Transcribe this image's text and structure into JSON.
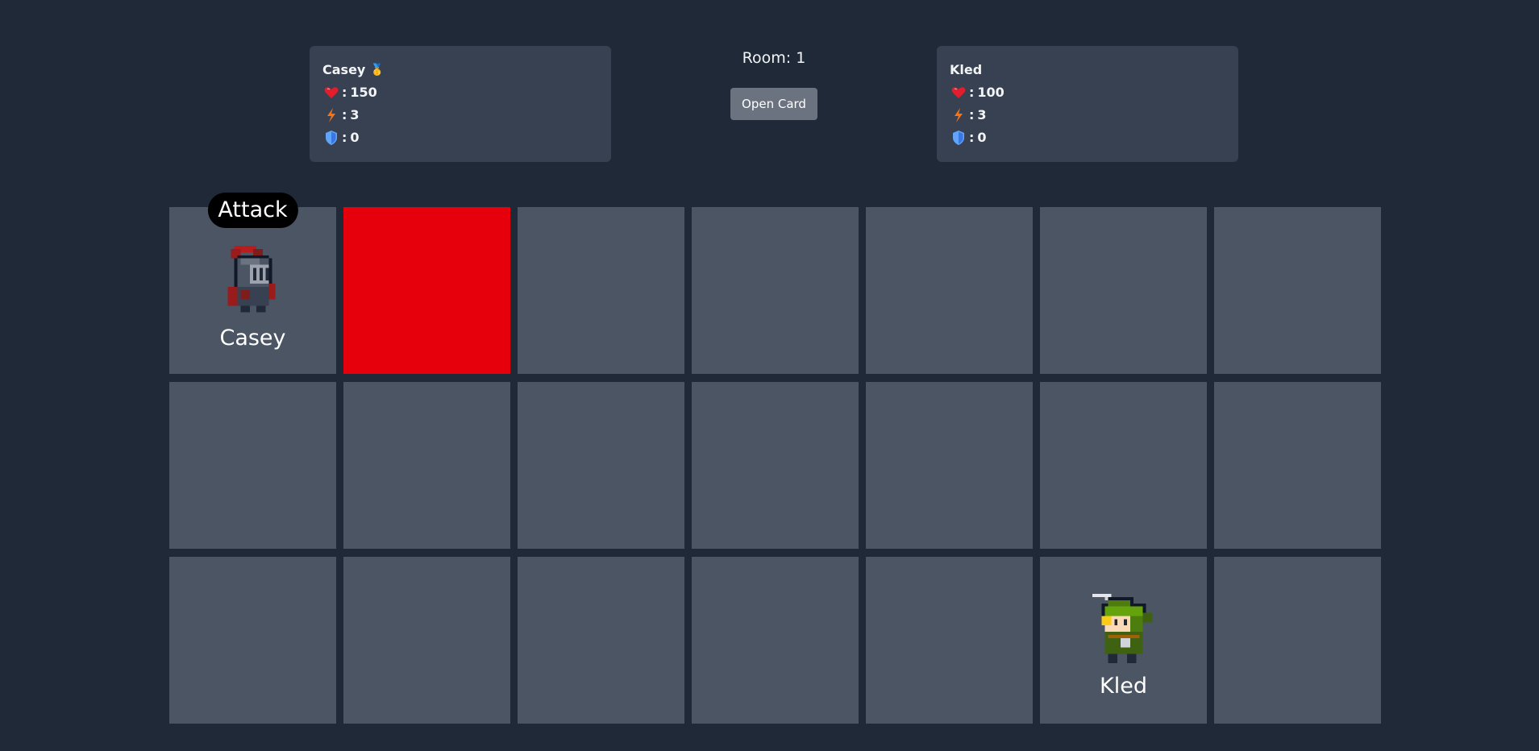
{
  "players": [
    {
      "name": "Casey",
      "badge_icon": "gold-medal-icon",
      "badge_glyph": "🥇",
      "hp": "150",
      "energy": "3",
      "shield": "0"
    },
    {
      "name": "Kled",
      "hp": "100",
      "energy": "3",
      "shield": "0"
    }
  ],
  "stat_separator": ":",
  "room": {
    "label": "Room: 1"
  },
  "open_card_button": "Open Card",
  "board": {
    "columns": 7,
    "rows": 3,
    "highlighted_cell": {
      "row": 1,
      "col": 2,
      "color": "#e5000c"
    },
    "units": [
      {
        "name": "Casey",
        "sprite": "knight-sprite-icon",
        "row": 1,
        "col": 1,
        "action": "Attack"
      },
      {
        "name": "Kled",
        "sprite": "elf-archer-sprite-icon",
        "row": 3,
        "col": 6
      }
    ]
  },
  "colors": {
    "background": "#1f2937",
    "panel": "#374151",
    "cell": "#4b5563",
    "button": "#6b7280",
    "highlight": "#e5000c"
  }
}
